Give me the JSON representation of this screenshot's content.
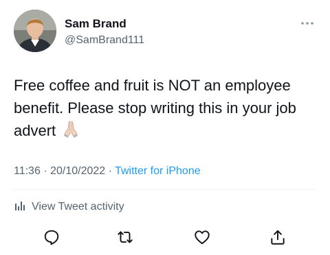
{
  "author": {
    "name": "Sam Brand",
    "handle": "@SamBrand111"
  },
  "tweet": {
    "text": "Free coffee and fruit is NOT an employee benefit. Please stop writing this in your job advert",
    "emoji": "folded-hands-emoji"
  },
  "meta": {
    "time": "11:36",
    "separator": "·",
    "date": "20/10/2022",
    "source": "Twitter for iPhone"
  },
  "activity": {
    "label": "View Tweet activity"
  },
  "icons": {
    "more": "more-horizontal-icon",
    "activity": "bar-chart-icon",
    "reply": "reply-icon",
    "retweet": "retweet-icon",
    "like": "heart-icon",
    "share": "share-icon"
  },
  "colors": {
    "text": "#0f1419",
    "secondary": "#536471",
    "link": "#1d9bf0",
    "divider": "#eff3f4"
  }
}
